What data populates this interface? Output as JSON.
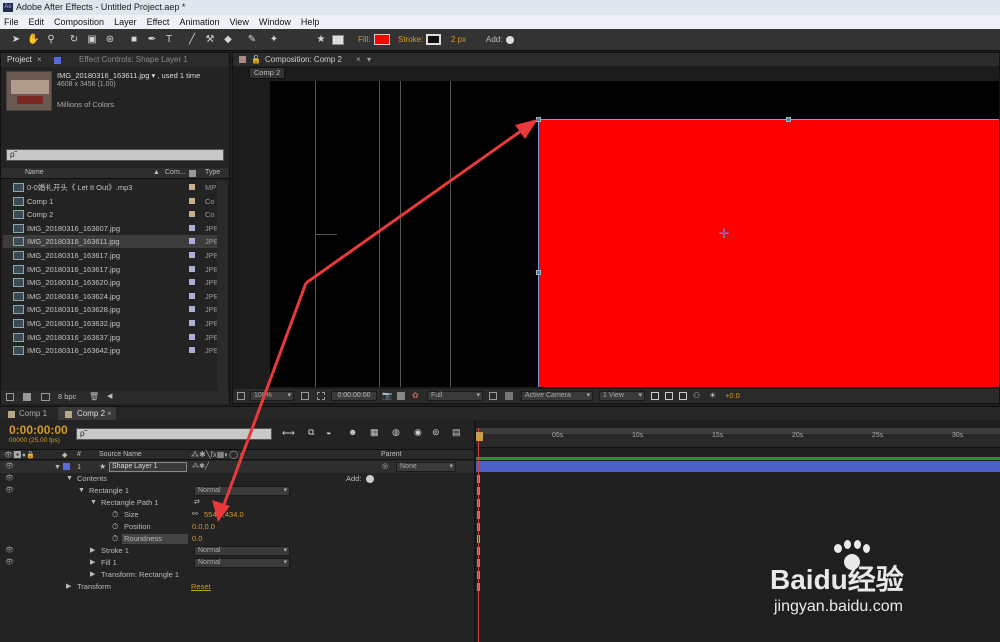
{
  "window": {
    "title": "Adobe After Effects - Untitled Project.aep *",
    "app_badge": "Ae"
  },
  "menu": [
    "File",
    "Edit",
    "Composition",
    "Layer",
    "Effect",
    "Animation",
    "View",
    "Window",
    "Help"
  ],
  "toolbar": {
    "fill_label": "Fill:",
    "stroke_label": "Stroke:",
    "stroke_width": "2 px",
    "add_label": "Add:",
    "fill_color": "#ff0000"
  },
  "project_panel": {
    "tab_project": "Project",
    "tab_effect_controls": "Effect Controls: Shape Layer 1",
    "preview_name": "IMG_20180316_163611.jpg ▾ , used 1 time",
    "preview_dims": "4608 x 3456 (1.00)",
    "preview_colors": "Millions of Colors",
    "search_placeholder": "ρ˜",
    "col_name": "Name",
    "col_comment": "Com...",
    "col_type": "Type",
    "items": [
      {
        "name": "0-0婚礼开头《 Let It Out》.mp3",
        "type": "MP",
        "label": "#c8b08a"
      },
      {
        "name": "Comp 1",
        "type": "Co",
        "label": "#c8b08a"
      },
      {
        "name": "Comp 2",
        "type": "Co",
        "label": "#c8b08a"
      },
      {
        "name": "IMG_20180316_163607.jpg",
        "type": "JPE",
        "label": "#aab0d8"
      },
      {
        "name": "IMG_20180316_163611.jpg",
        "type": "JPE",
        "label": "#aab0d8"
      },
      {
        "name": "IMG_20180316_163617.jpg",
        "type": "JPE",
        "label": "#aab0d8"
      },
      {
        "name": "IMG_20180316_163617.jpg",
        "type": "JPE",
        "label": "#aab0d8"
      },
      {
        "name": "IMG_20180316_163620.jpg",
        "type": "JPE",
        "label": "#aab0d8"
      },
      {
        "name": "IMG_20180316_163624.jpg",
        "type": "JPE",
        "label": "#aab0d8"
      },
      {
        "name": "IMG_20180316_163628.jpg",
        "type": "JPE",
        "label": "#aab0d8"
      },
      {
        "name": "IMG_20180316_163632.jpg",
        "type": "JPE",
        "label": "#aab0d8"
      },
      {
        "name": "IMG_20180316_163637.jpg",
        "type": "JPE",
        "label": "#aab0d8"
      },
      {
        "name": "IMG_20180316_163642.jpg",
        "type": "JPE",
        "label": "#aab0d8"
      }
    ],
    "bpc": "8 bpc"
  },
  "composition_panel": {
    "tab": "Composition: Comp 2",
    "breadcrumb": "Comp 2",
    "zoom": "100%",
    "timecode": "0:00:00:00",
    "resolution": "Full",
    "camera": "Active Camera",
    "views": "1 View",
    "exposure": "+0.0",
    "shape_color": "#ff0000"
  },
  "timeline": {
    "tab_comp1": "Comp 1",
    "tab_comp2": "Comp 2",
    "timecode": "0:00:00:00",
    "fps": "00000 (25.00 fps)",
    "search_placeholder": "ρ˜",
    "col_num": "#",
    "col_source": "Source Name",
    "col_parent": "Parent",
    "layer_num": "1",
    "layer_name": "Shape Layer 1",
    "parent_value": "None",
    "contents": "Contents",
    "add_label": "Add:",
    "rect1": "Rectangle 1",
    "rect1_mode": "Normal",
    "rect_path": "Rectangle Path 1",
    "size_label": "Size",
    "size_value": "554.0,434.0",
    "position_label": "Position",
    "position_value": "0.0,0.0",
    "roundness_label": "Roundness",
    "roundness_value": "0.0",
    "stroke1": "Stroke 1",
    "stroke1_mode": "Normal",
    "fill1": "Fill 1",
    "fill1_mode": "Normal",
    "transform_rect": "Transform: Rectangle 1",
    "transform": "Transform",
    "reset": "Reset",
    "ruler": [
      "0s",
      "05s",
      "10s",
      "15s",
      "20s",
      "25s",
      "30s"
    ]
  },
  "watermark": {
    "brand": "Baidu经验",
    "url": "jingyan.baidu.com"
  }
}
